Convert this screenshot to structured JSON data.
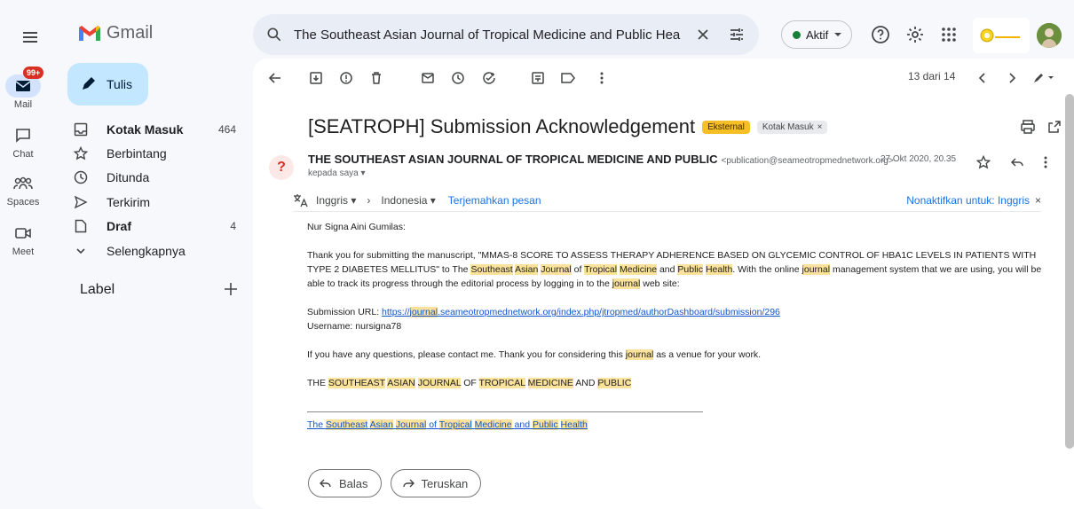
{
  "app": {
    "name": "Gmail"
  },
  "search": {
    "query": "The Southeast Asian Journal of Tropical Medicine and Public Health"
  },
  "status": {
    "label": "Aktif"
  },
  "rail": [
    {
      "label": "Mail",
      "badge": "99+"
    },
    {
      "label": "Chat"
    },
    {
      "label": "Spaces"
    },
    {
      "label": "Meet"
    }
  ],
  "compose": {
    "label": "Tulis"
  },
  "nav": {
    "items": [
      {
        "label": "Kotak Masuk",
        "count": "464"
      },
      {
        "label": "Berbintang",
        "count": ""
      },
      {
        "label": "Ditunda",
        "count": ""
      },
      {
        "label": "Terkirim",
        "count": ""
      },
      {
        "label": "Draf",
        "count": "4"
      },
      {
        "label": "Selengkapnya",
        "count": ""
      }
    ],
    "label_heading": "Label"
  },
  "toolbar": {
    "pager": "13 dari 14"
  },
  "email": {
    "subject": "[SEATROPH] Submission Acknowledgement",
    "chip_external": "Eksternal",
    "chip_inbox": "Kotak Masuk",
    "chip_inbox_close": "×",
    "sender_name": "THE SOUTHEAST ASIAN JOURNAL OF TROPICAL MEDICINE AND PUBLIC",
    "sender_email": "<publication@seameotropmednetwork.org>",
    "to": "kepada saya",
    "date": "27 Okt 2020, 20.35",
    "translate": {
      "from": "Inggris",
      "to": "Indonesia",
      "action": "Terjemahkan pesan",
      "disable": "Nonaktifkan untuk: Inggris",
      "close": "×"
    },
    "body": {
      "greeting": "Nur Signa Aini Gumilas:",
      "p1_a": "Thank you for submitting the manuscript, \"MMAS-8 SCORE TO ASSESS THERAPY ADHERENCE BASED ON GLYCEMIC CONTROL OF HBA1C LEVELS IN PATIENTS WITH TYPE 2 DIABETES MELLITUS\" to The ",
      "p1_southeast": "Southeast",
      "p1_asian": "Asian",
      "p1_journal": "Journal",
      "p1_of": " of ",
      "p1_tropical": "Tropical",
      "p1_medicine": "Medicine",
      "p1_and": " and ",
      "p1_public": "Public",
      "p1_health": "Health",
      "p1_b": ". With the online ",
      "p1_journal2": "journal",
      "p1_c": " management system that we are using, you will be able to track its progress through the editorial process by logging in to the ",
      "p1_journal3": "journal",
      "p1_d": " web site:",
      "url_label": "Submission URL: ",
      "url_a": "https://",
      "url_journal": "journal",
      "url_b": ".seameotropmednetwork.org/index.php/jtropmed/authorDashboard/submission/296",
      "username": "Username: nursigna78",
      "p3_a": "If you have any questions, please contact me. Thank you for considering this ",
      "p3_journal": "journal",
      "p3_b": " as a venue for your work.",
      "sig_the": "THE ",
      "sig_southeast": "SOUTHEAST",
      "sig_asian": "ASIAN",
      "sig_journal": "JOURNAL",
      "sig_of": " OF ",
      "sig_tropical": "TROPICAL",
      "sig_medicine": "MEDICINE",
      "sig_and": " AND ",
      "sig_public": "PUBLIC",
      "footer_the": "The ",
      "footer_southeast": "Southeast",
      "footer_asian": "Asian",
      "footer_journal": "Journal",
      "footer_of": " of ",
      "footer_tropical": "Tropical",
      "footer_medicine": "Medicine",
      "footer_and": " and ",
      "footer_public": "Public",
      "footer_health": "Health"
    },
    "reply": "Balas",
    "forward": "Teruskan"
  }
}
